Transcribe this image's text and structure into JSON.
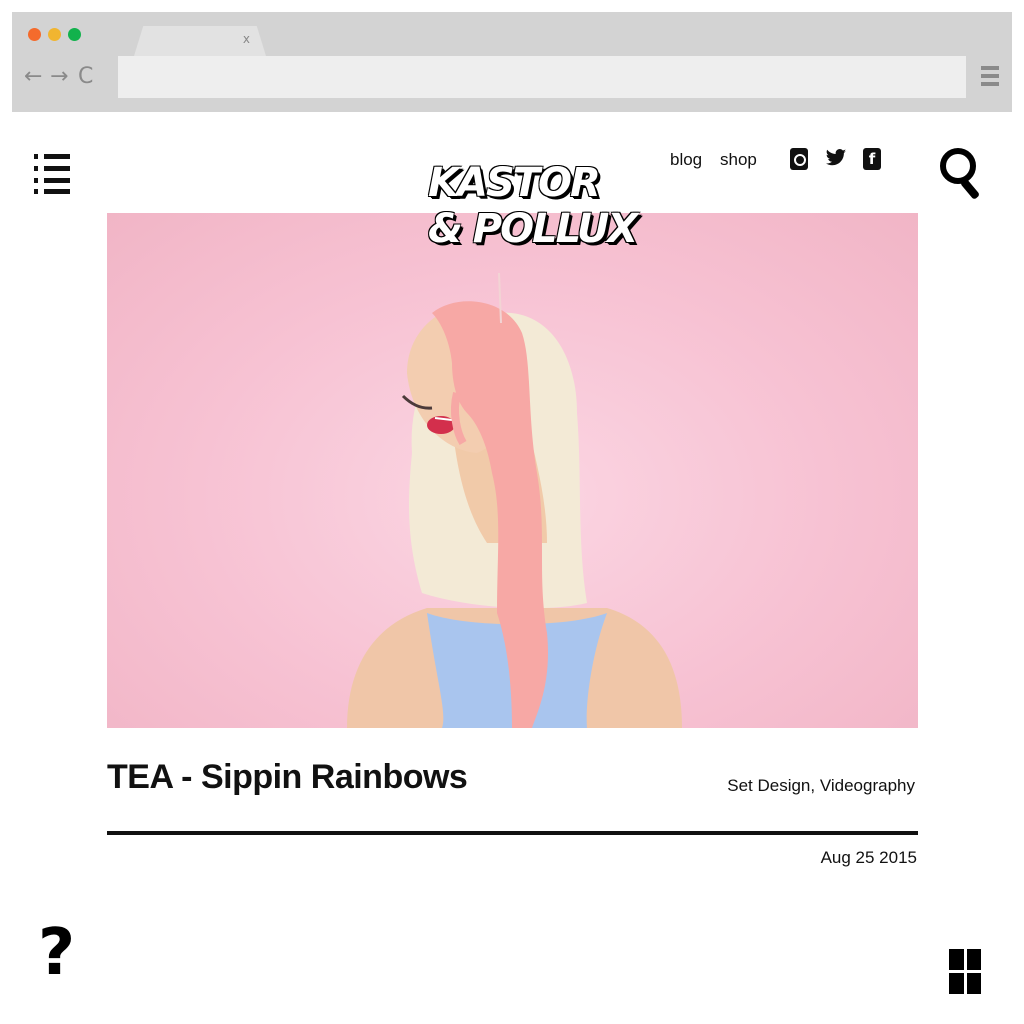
{
  "browser": {
    "tab": {
      "close_label": "x"
    },
    "nav": {
      "back": "←",
      "forward": "→",
      "reload": "C"
    }
  },
  "site": {
    "logo_line1": "KASTOR",
    "logo_line2": "& POLLUX",
    "nav": {
      "blog": "blog",
      "shop": "shop"
    },
    "social": {
      "twitter": "🐦",
      "facebook": "f"
    }
  },
  "post": {
    "title": "TEA - Sippin Rainbows",
    "categories": "Set Design, Videography",
    "date": "Aug 25 2015"
  },
  "footer": {
    "help": "?"
  },
  "icons": {
    "list_menu": "list-menu-icon",
    "search": "search-icon",
    "help": "question-mark-icon",
    "grid": "grid-icon",
    "instagram": "instagram-icon",
    "twitter": "twitter-icon",
    "facebook": "facebook-icon"
  },
  "colors": {
    "chrome": "#d3d3d3",
    "hero_background": "#f7c2d3",
    "text": "#111111"
  }
}
